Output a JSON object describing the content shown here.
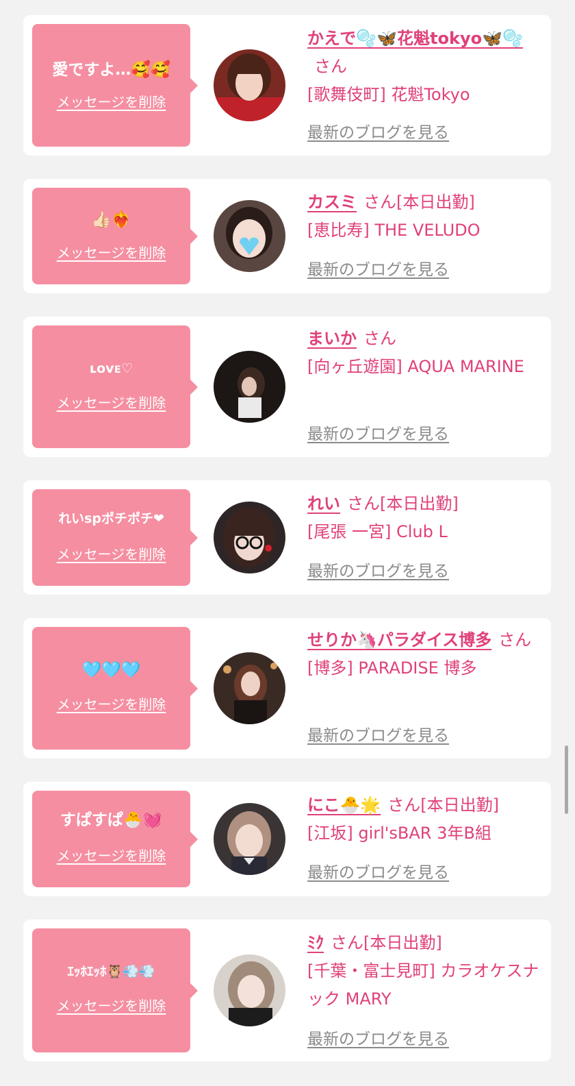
{
  "colors": {
    "background": "#f2f2f2",
    "card": "#ffffff",
    "bubble": "#f58ea1",
    "accent": "#e0407a",
    "link_gray": "#8a8a8a"
  },
  "delete_label": "メッセージを削除",
  "blog_label": "最新のブログを見る",
  "san_label": "さん",
  "today_label": "[本日出勤]",
  "cards": [
    {
      "message": "愛ですよ…🥰🥰",
      "name": "かえで🫧🦋花魁tokyo🦋🫧",
      "today": "",
      "shop": "[歌舞伎町] 花魁Tokyo",
      "avatar_icon": "avatar-photo"
    },
    {
      "message": "👍🏻❤️‍🔥",
      "name": "カスミ",
      "today": "[本日出勤]",
      "shop": "[恵比寿] THE VELUDO",
      "avatar_icon": "avatar-photo"
    },
    {
      "message": "ʟᴏᴠᴇ♡",
      "name": "まいか",
      "today": "",
      "shop": "[向ヶ丘遊園] AQUA MARINE",
      "avatar_icon": "avatar-photo"
    },
    {
      "message": "れいspポチポチ❤︎",
      "name": "れい",
      "today": "[本日出勤]",
      "shop": "[尾張 一宮] Club L",
      "avatar_icon": "avatar-photo"
    },
    {
      "message": "🩵🩵🩵",
      "name": "せりか🦄パラダイス博多",
      "today": "",
      "shop": "[博多] PARADISE 博多",
      "avatar_icon": "avatar-photo"
    },
    {
      "message": "すぱすぱ🐣💓",
      "name": "にこ🐣🌟",
      "today": "[本日出勤]",
      "shop": "[江坂] girl'sBAR 3年B組",
      "avatar_icon": "avatar-photo"
    },
    {
      "message": "ｴｯﾎｴｯﾎ🦉💨💨",
      "name": "ﾐｸ",
      "today": "[本日出勤]",
      "shop": "[千葉・富士見町] カラオケスナック MARY",
      "avatar_icon": "avatar-photo"
    }
  ]
}
